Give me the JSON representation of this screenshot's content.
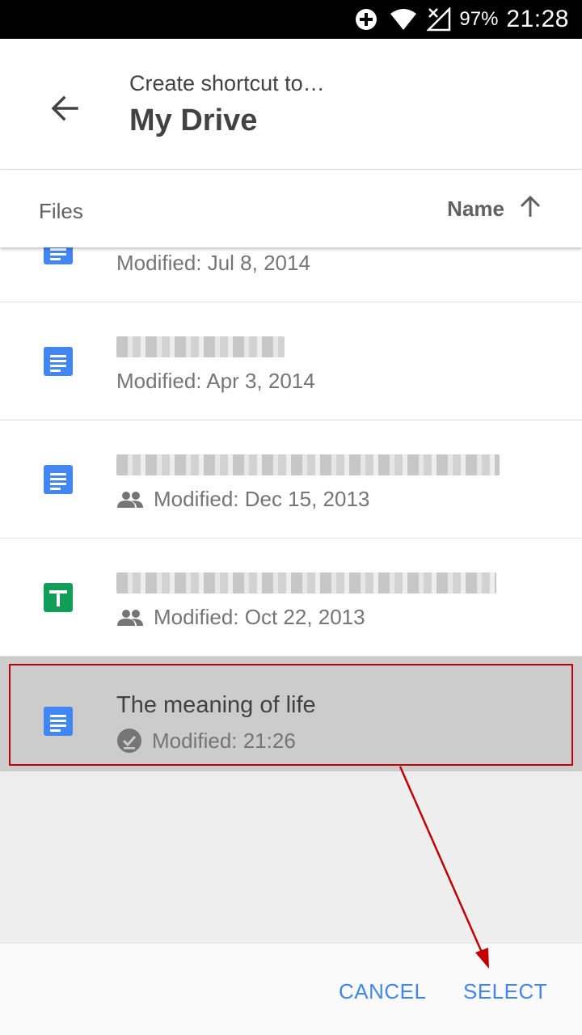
{
  "status_bar": {
    "battery": "97%",
    "time": "21:28",
    "icons": [
      "data-saver-icon",
      "wifi-icon",
      "no-signal-icon"
    ]
  },
  "app_bar": {
    "subtitle": "Create shortcut to…",
    "title": "My Drive"
  },
  "list_header": {
    "section_label": "Files",
    "sort_label": "Name"
  },
  "files": [
    {
      "name": "",
      "blurred": true,
      "type": "doc",
      "shared": false,
      "meta": "Modified: Jul 8, 2014"
    },
    {
      "name": "",
      "blurred": true,
      "type": "doc",
      "shared": false,
      "meta": "Modified: Apr 3, 2014"
    },
    {
      "name": "",
      "blurred": true,
      "type": "doc",
      "shared": true,
      "meta": "Modified: Dec 15, 2013"
    },
    {
      "name": "",
      "blurred": true,
      "type": "sheet",
      "shared": true,
      "meta": "Modified: Oct 22, 2013"
    },
    {
      "name": "The meaning of life",
      "blurred": false,
      "type": "doc",
      "shared": false,
      "selected": true,
      "meta": "Modified: 21:26"
    }
  ],
  "actions": {
    "cancel": "CANCEL",
    "select": "SELECT"
  },
  "colors": {
    "accent": "#4285f4",
    "doc_icon": "#4285f4",
    "sheet_icon": "#0f9d58",
    "selected_row": "#cccccc",
    "annotation": "#c00000"
  }
}
